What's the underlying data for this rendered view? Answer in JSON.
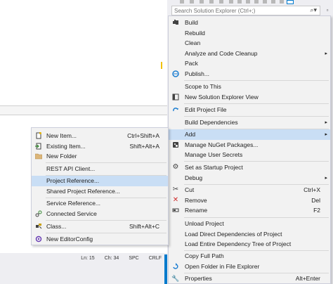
{
  "search": {
    "placeholder": "Search Solution Explorer (Ctrl+;)"
  },
  "statusbar": {
    "line": "Ln: 15",
    "char": "Ch: 34",
    "spc": "SPC",
    "crlf": "CRLF"
  },
  "context_menu": {
    "items": [
      {
        "label": "Build",
        "icon": "build-icon"
      },
      {
        "label": "Rebuild",
        "icon": ""
      },
      {
        "label": "Clean",
        "icon": ""
      },
      {
        "label": "Analyze and Code Cleanup",
        "icon": "",
        "submenu": true
      },
      {
        "label": "Pack",
        "icon": ""
      },
      {
        "label": "Publish...",
        "icon": "publish-icon"
      },
      {
        "label": "Scope to This",
        "icon": ""
      },
      {
        "label": "New Solution Explorer View",
        "icon": "new-view-icon"
      },
      {
        "label": "Edit Project File",
        "icon": "edit-icon"
      },
      {
        "label": "Build Dependencies",
        "icon": "",
        "submenu": true
      },
      {
        "label": "Add",
        "icon": "",
        "submenu": true
      },
      {
        "label": "Manage NuGet Packages...",
        "icon": "nuget-icon"
      },
      {
        "label": "Manage User Secrets",
        "icon": ""
      },
      {
        "label": "Set as Startup Project",
        "icon": "gear-icon"
      },
      {
        "label": "Debug",
        "icon": "",
        "submenu": true
      },
      {
        "label": "Cut",
        "icon": "scissors-icon",
        "shortcut": "Ctrl+X"
      },
      {
        "label": "Remove",
        "icon": "remove-icon",
        "shortcut": "Del"
      },
      {
        "label": "Rename",
        "icon": "rename-icon",
        "shortcut": "F2"
      },
      {
        "label": "Unload Project",
        "icon": ""
      },
      {
        "label": "Load Direct Dependencies of Project",
        "icon": ""
      },
      {
        "label": "Load Entire Dependency Tree of Project",
        "icon": ""
      },
      {
        "label": "Copy Full Path",
        "icon": ""
      },
      {
        "label": "Open Folder in File Explorer",
        "icon": "refresh-icon"
      },
      {
        "label": "Properties",
        "icon": "wrench-icon",
        "shortcut": "Alt+Enter"
      }
    ]
  },
  "add_submenu": {
    "items": [
      {
        "label": "New Item...",
        "icon": "new-item-icon",
        "shortcut": "Ctrl+Shift+A"
      },
      {
        "label": "Existing Item...",
        "icon": "existing-item-icon",
        "shortcut": "Shift+Alt+A"
      },
      {
        "label": "New Folder",
        "icon": "folder-icon"
      },
      {
        "label": "REST API Client...",
        "icon": ""
      },
      {
        "label": "Project Reference...",
        "icon": ""
      },
      {
        "label": "Shared Project Reference...",
        "icon": ""
      },
      {
        "label": "Service Reference...",
        "icon": ""
      },
      {
        "label": "Connected Service",
        "icon": "connected-service-icon"
      },
      {
        "label": "Class...",
        "icon": "class-icon",
        "shortcut": "Shift+Alt+C"
      },
      {
        "label": "New EditorConfig",
        "icon": "editorconfig-icon"
      }
    ]
  },
  "colors": {
    "accent": "#007acc",
    "highlight": "#c9def5",
    "menu_bg": "#f2f2f2"
  }
}
